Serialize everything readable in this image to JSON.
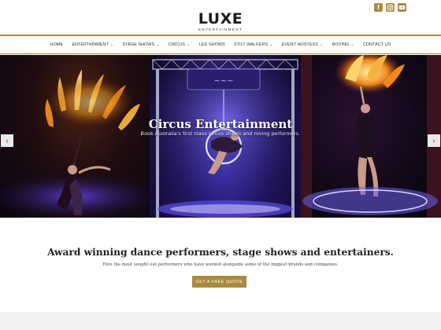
{
  "brand": {
    "name": "LUXE",
    "tagline": "ENTERTAINMENT"
  },
  "social": {
    "facebook": "f",
    "instagram": "instagram-icon",
    "youtube": "youtube-icon"
  },
  "nav": {
    "items": [
      {
        "label": "HOME",
        "dropdown": false
      },
      {
        "label": "ENTERTAINMENT",
        "dropdown": true
      },
      {
        "label": "STAGE SHOWS",
        "dropdown": true
      },
      {
        "label": "CIRCUS",
        "dropdown": true
      },
      {
        "label": "LED SHOWS",
        "dropdown": false
      },
      {
        "label": "STILT WALKERS",
        "dropdown": true
      },
      {
        "label": "EVENT HOSTESS",
        "dropdown": true
      },
      {
        "label": "ROVING",
        "dropdown": true
      },
      {
        "label": "CONTACT US",
        "dropdown": false
      }
    ],
    "caret": "⌄"
  },
  "hero": {
    "title": "Circus Entertainment",
    "subtitle": "Book Australia's first class circus shows and roving performers.",
    "prev": "‹",
    "next": "›"
  },
  "intro": {
    "title": "Award winning dance performers, stage shows and entertainers.",
    "text": "Hire the most sought out performers who have worked alongside some of the biggest brands and companies.",
    "cta": "GET A FREE QUOTE"
  },
  "colors": {
    "accent": "#a88b3e"
  }
}
